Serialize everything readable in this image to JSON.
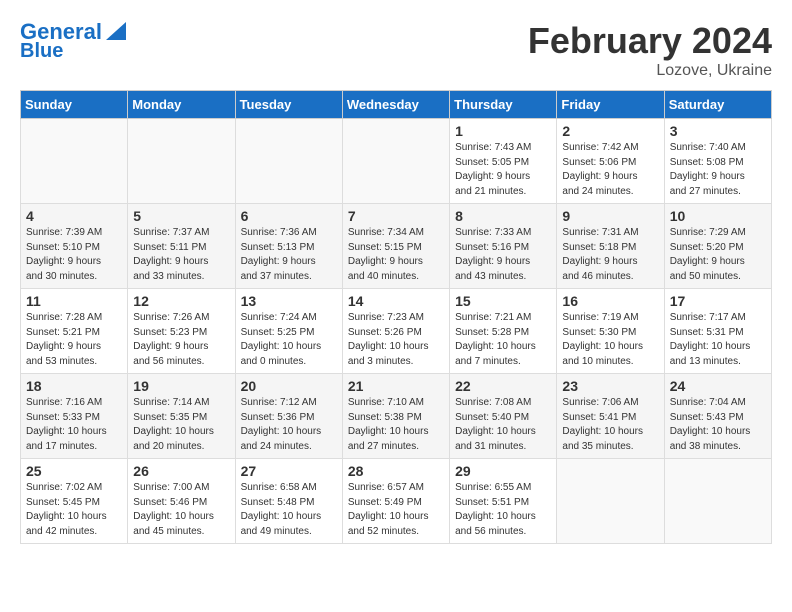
{
  "header": {
    "logo_line1": "General",
    "logo_line2": "Blue",
    "month": "February 2024",
    "location": "Lozove, Ukraine"
  },
  "weekdays": [
    "Sunday",
    "Monday",
    "Tuesday",
    "Wednesday",
    "Thursday",
    "Friday",
    "Saturday"
  ],
  "weeks": [
    [
      {
        "day": "",
        "detail": ""
      },
      {
        "day": "",
        "detail": ""
      },
      {
        "day": "",
        "detail": ""
      },
      {
        "day": "",
        "detail": ""
      },
      {
        "day": "1",
        "detail": "Sunrise: 7:43 AM\nSunset: 5:05 PM\nDaylight: 9 hours\nand 21 minutes."
      },
      {
        "day": "2",
        "detail": "Sunrise: 7:42 AM\nSunset: 5:06 PM\nDaylight: 9 hours\nand 24 minutes."
      },
      {
        "day": "3",
        "detail": "Sunrise: 7:40 AM\nSunset: 5:08 PM\nDaylight: 9 hours\nand 27 minutes."
      }
    ],
    [
      {
        "day": "4",
        "detail": "Sunrise: 7:39 AM\nSunset: 5:10 PM\nDaylight: 9 hours\nand 30 minutes."
      },
      {
        "day": "5",
        "detail": "Sunrise: 7:37 AM\nSunset: 5:11 PM\nDaylight: 9 hours\nand 33 minutes."
      },
      {
        "day": "6",
        "detail": "Sunrise: 7:36 AM\nSunset: 5:13 PM\nDaylight: 9 hours\nand 37 minutes."
      },
      {
        "day": "7",
        "detail": "Sunrise: 7:34 AM\nSunset: 5:15 PM\nDaylight: 9 hours\nand 40 minutes."
      },
      {
        "day": "8",
        "detail": "Sunrise: 7:33 AM\nSunset: 5:16 PM\nDaylight: 9 hours\nand 43 minutes."
      },
      {
        "day": "9",
        "detail": "Sunrise: 7:31 AM\nSunset: 5:18 PM\nDaylight: 9 hours\nand 46 minutes."
      },
      {
        "day": "10",
        "detail": "Sunrise: 7:29 AM\nSunset: 5:20 PM\nDaylight: 9 hours\nand 50 minutes."
      }
    ],
    [
      {
        "day": "11",
        "detail": "Sunrise: 7:28 AM\nSunset: 5:21 PM\nDaylight: 9 hours\nand 53 minutes."
      },
      {
        "day": "12",
        "detail": "Sunrise: 7:26 AM\nSunset: 5:23 PM\nDaylight: 9 hours\nand 56 minutes."
      },
      {
        "day": "13",
        "detail": "Sunrise: 7:24 AM\nSunset: 5:25 PM\nDaylight: 10 hours\nand 0 minutes."
      },
      {
        "day": "14",
        "detail": "Sunrise: 7:23 AM\nSunset: 5:26 PM\nDaylight: 10 hours\nand 3 minutes."
      },
      {
        "day": "15",
        "detail": "Sunrise: 7:21 AM\nSunset: 5:28 PM\nDaylight: 10 hours\nand 7 minutes."
      },
      {
        "day": "16",
        "detail": "Sunrise: 7:19 AM\nSunset: 5:30 PM\nDaylight: 10 hours\nand 10 minutes."
      },
      {
        "day": "17",
        "detail": "Sunrise: 7:17 AM\nSunset: 5:31 PM\nDaylight: 10 hours\nand 13 minutes."
      }
    ],
    [
      {
        "day": "18",
        "detail": "Sunrise: 7:16 AM\nSunset: 5:33 PM\nDaylight: 10 hours\nand 17 minutes."
      },
      {
        "day": "19",
        "detail": "Sunrise: 7:14 AM\nSunset: 5:35 PM\nDaylight: 10 hours\nand 20 minutes."
      },
      {
        "day": "20",
        "detail": "Sunrise: 7:12 AM\nSunset: 5:36 PM\nDaylight: 10 hours\nand 24 minutes."
      },
      {
        "day": "21",
        "detail": "Sunrise: 7:10 AM\nSunset: 5:38 PM\nDaylight: 10 hours\nand 27 minutes."
      },
      {
        "day": "22",
        "detail": "Sunrise: 7:08 AM\nSunset: 5:40 PM\nDaylight: 10 hours\nand 31 minutes."
      },
      {
        "day": "23",
        "detail": "Sunrise: 7:06 AM\nSunset: 5:41 PM\nDaylight: 10 hours\nand 35 minutes."
      },
      {
        "day": "24",
        "detail": "Sunrise: 7:04 AM\nSunset: 5:43 PM\nDaylight: 10 hours\nand 38 minutes."
      }
    ],
    [
      {
        "day": "25",
        "detail": "Sunrise: 7:02 AM\nSunset: 5:45 PM\nDaylight: 10 hours\nand 42 minutes."
      },
      {
        "day": "26",
        "detail": "Sunrise: 7:00 AM\nSunset: 5:46 PM\nDaylight: 10 hours\nand 45 minutes."
      },
      {
        "day": "27",
        "detail": "Sunrise: 6:58 AM\nSunset: 5:48 PM\nDaylight: 10 hours\nand 49 minutes."
      },
      {
        "day": "28",
        "detail": "Sunrise: 6:57 AM\nSunset: 5:49 PM\nDaylight: 10 hours\nand 52 minutes."
      },
      {
        "day": "29",
        "detail": "Sunrise: 6:55 AM\nSunset: 5:51 PM\nDaylight: 10 hours\nand 56 minutes."
      },
      {
        "day": "",
        "detail": ""
      },
      {
        "day": "",
        "detail": ""
      }
    ]
  ]
}
